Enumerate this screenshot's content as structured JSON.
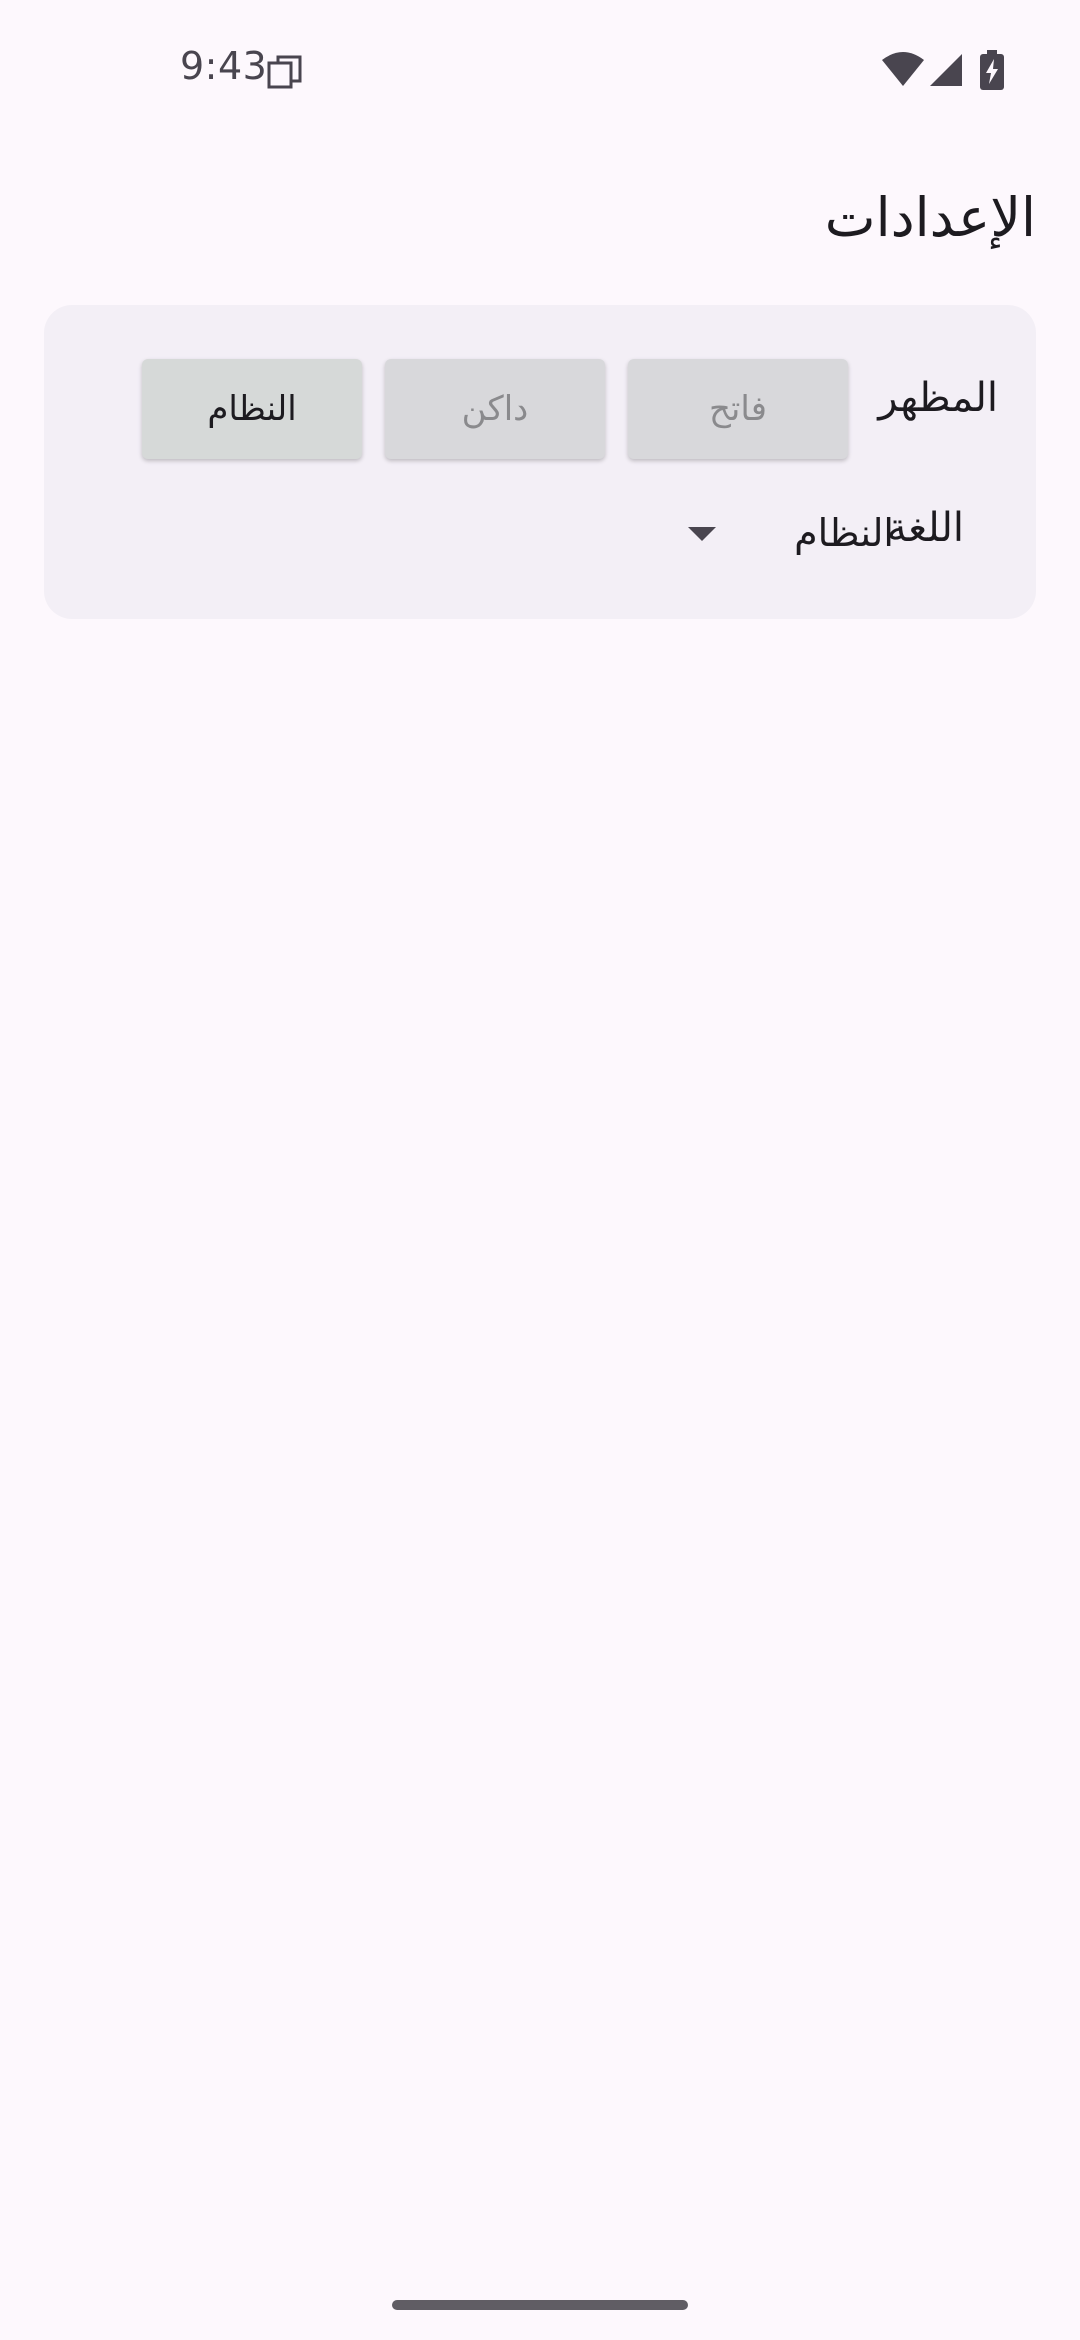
{
  "status_bar": {
    "time": "9:43",
    "icons": [
      "copy-icon",
      "wifi-icon",
      "signal-icon",
      "battery-charging-icon"
    ]
  },
  "header": {
    "title": "الإعدادات"
  },
  "settings": {
    "appearance": {
      "label": "المظهر",
      "options": [
        "فاتح",
        "داكن",
        "النظام"
      ],
      "selected": "النظام"
    },
    "language": {
      "label": "اللغة",
      "value": "النظام"
    }
  },
  "colors": {
    "background": "#fdf8fd",
    "card": "#f3eff6",
    "button": "#d8d8db",
    "text": "#1d1b20",
    "muted_text": "#8a8a8d"
  }
}
